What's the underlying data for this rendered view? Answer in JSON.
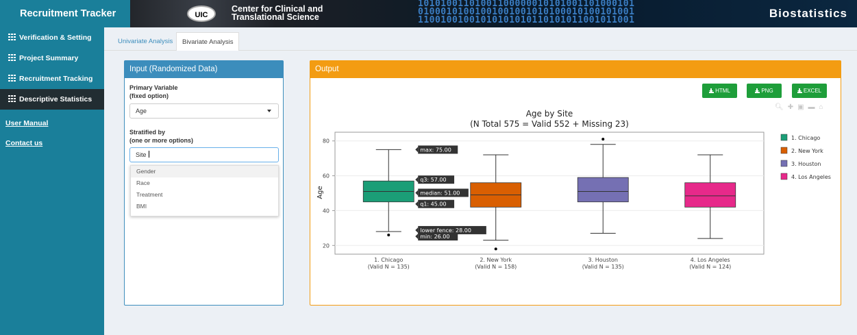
{
  "app": {
    "brand": "Recruitment Tracker",
    "banner_logo": "UIC",
    "banner_title_line1": "Center for Clinical and",
    "banner_title_line2": "Translational Science",
    "banner_right": "Biostatistics",
    "banner_binary": [
      "10101001101001100000010101001101000101",
      "01000101001001001001010100010100101001",
      "11001001001010101010110101011001011001"
    ]
  },
  "sidebar": {
    "items": [
      {
        "label": "Verification & Setting",
        "icon": "table-icon",
        "active": false
      },
      {
        "label": "Project Summary",
        "icon": "table-icon",
        "active": false
      },
      {
        "label": "Recruitment Tracking",
        "icon": "table-icon",
        "active": false
      },
      {
        "label": "Descriptive Statistics",
        "icon": "table-icon",
        "active": true
      }
    ],
    "links": [
      "User Manual",
      "Contact us"
    ]
  },
  "tabs": [
    {
      "label": "Univariate Analysis",
      "active": false
    },
    {
      "label": "Bivariate Analysis",
      "active": true
    }
  ],
  "input_panel": {
    "title": "Input (Randomized Data)",
    "primary_label_line1": "Primary Variable",
    "primary_label_line2": "(fixed option)",
    "primary_value": "Age",
    "strat_label_line1": "Stratified by",
    "strat_label_line2": "(one or more options)",
    "strat_value": "Site",
    "options": [
      "Gender",
      "Race",
      "Treatment",
      "BMI"
    ]
  },
  "output_panel": {
    "title": "Output",
    "buttons": [
      "HTML",
      "PNG",
      "EXCEL"
    ]
  },
  "chart_data": {
    "type": "box",
    "title": "Age by Site",
    "subtitle": "(N Total 575 = Valid 552 + Missing 23)",
    "ylabel": "Age",
    "ylim": [
      15,
      85
    ],
    "yticks": [
      20,
      40,
      60,
      80
    ],
    "grid": true,
    "legend": "right",
    "categories": [
      {
        "tick": "1. Chicago",
        "sub": "(Valid N = 135)"
      },
      {
        "tick": "2. New York",
        "sub": "(Valid N = 158)"
      },
      {
        "tick": "3. Houston",
        "sub": "(Valid N = 135)"
      },
      {
        "tick": "4. Los Angeles",
        "sub": "(Valid N = 124)"
      }
    ],
    "series": [
      {
        "name": "1. Chicago",
        "color": "#1b9e77",
        "upper_fence": 75,
        "q3": 57,
        "median": 51,
        "q1": 45,
        "lower_fence": 28,
        "outliers": [
          26
        ]
      },
      {
        "name": "2. New York",
        "color": "#d95f02",
        "upper_fence": 72,
        "q3": 56,
        "median": 49,
        "q1": 42,
        "lower_fence": 23,
        "outliers": [
          18
        ]
      },
      {
        "name": "3. Houston",
        "color": "#7570b3",
        "upper_fence": 78,
        "q3": 59,
        "median": 51,
        "q1": 45,
        "lower_fence": 27,
        "outliers": [
          81
        ]
      },
      {
        "name": "4. Los Angeles",
        "color": "#e7298a",
        "upper_fence": 72,
        "q3": 56,
        "median": 48.5,
        "q1": 42,
        "lower_fence": 24,
        "outliers": []
      }
    ],
    "hover_labels": [
      {
        "text": "max: 75.00",
        "value": 75
      },
      {
        "text": "q3: 57.00",
        "value": 57
      },
      {
        "text": "median: 51.00",
        "value": 51
      },
      {
        "text": "q1: 45.00",
        "value": 45
      },
      {
        "text": "lower fence: 28.00",
        "value": 28
      },
      {
        "text": "min: 26.00",
        "value": 26
      }
    ]
  }
}
